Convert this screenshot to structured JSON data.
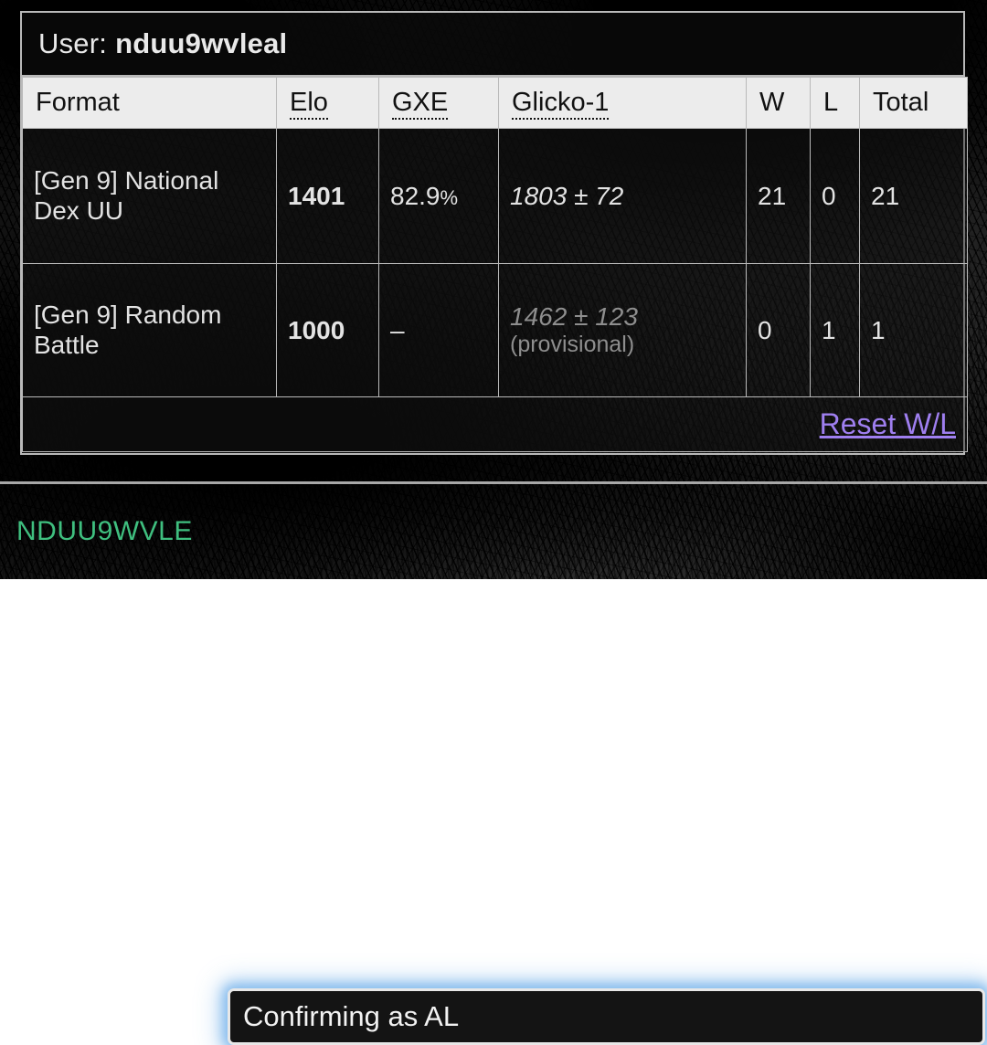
{
  "background": {
    "description": "dark grayscale manga panel artwork",
    "base_color": "#242424"
  },
  "ratings_panel": {
    "user_label": "User:",
    "username": "nduu9wvleal",
    "columns": [
      {
        "key": "format",
        "label": "Format",
        "abbr": false
      },
      {
        "key": "elo",
        "label": "Elo",
        "abbr": true
      },
      {
        "key": "gxe",
        "label": "GXE",
        "abbr": true
      },
      {
        "key": "glicko",
        "label": "Glicko-1",
        "abbr": true
      },
      {
        "key": "w",
        "label": "W",
        "abbr": false
      },
      {
        "key": "l",
        "label": "L",
        "abbr": false
      },
      {
        "key": "total",
        "label": "Total",
        "abbr": false
      }
    ],
    "rows": [
      {
        "format": "[Gen 9] National Dex UU",
        "elo": "1401",
        "gxe": "82.9",
        "gxe_unit": "%",
        "glicko": "1803 ± 72",
        "glicko_note": "",
        "provisional": false,
        "w": "21",
        "l": "0",
        "total": "21"
      },
      {
        "format": "[Gen 9] Random Battle",
        "elo": "1000",
        "gxe": "–",
        "gxe_unit": "",
        "glicko": "1462 ± 123",
        "glicko_note": "(provisional)",
        "provisional": true,
        "w": "0",
        "l": "1",
        "total": "1"
      }
    ],
    "reset_link": "Reset W/L",
    "link_color": "#9f7ff0"
  },
  "chat": {
    "username": "NDUU9WVLE",
    "message_value": "Confirming as AL",
    "placeholder": "",
    "username_color": "#3fbf7f",
    "focus_glow_color": "#78b4eb"
  }
}
